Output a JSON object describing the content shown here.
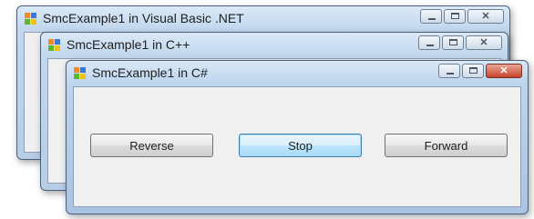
{
  "windows": [
    {
      "title": "SmcExample1 in Visual Basic .NET"
    },
    {
      "title": "SmcExample1 in C++"
    },
    {
      "title": "SmcExample1 in C#"
    }
  ],
  "window_controls": {
    "minimize": "minimize-icon",
    "maximize": "maximize-icon",
    "close": "close-icon"
  },
  "buttons": {
    "reverse": "Reverse",
    "stop": "Stop",
    "forward": "Forward"
  },
  "colors": {
    "titlebar": "#c3d8ee",
    "close_button": "#c7432a",
    "focus_border": "#3c7fb1"
  }
}
